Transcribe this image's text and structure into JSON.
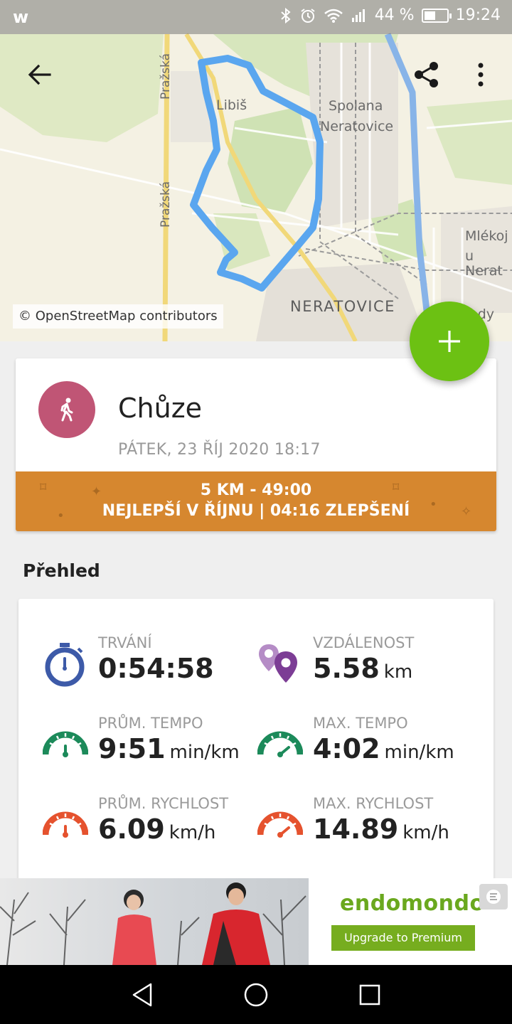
{
  "status_bar": {
    "app_glyph": "w",
    "battery_text": "44 %",
    "battery_level": 0.44,
    "time": "19:24"
  },
  "map": {
    "labels": {
      "prazska_top": "Pražská",
      "prazska_bottom": "Pražská",
      "libis": "Libiš",
      "spolana": "Spolana",
      "neratovice_upper": "Neratovice",
      "mlekojedy": "Mlékoj",
      "u_nerat": "u Nerat",
      "neratovice_town": "NERATOVICE",
      "edy": "edy"
    },
    "credit": "© OpenStreetMap contributors",
    "route_color": "#5aa6ef"
  },
  "actions": {
    "back_icon": "arrow-back-icon",
    "share_icon": "share-icon",
    "more_icon": "more-vertical-icon",
    "add_icon": "plus-icon"
  },
  "workout": {
    "activity_icon": "walking-person-icon",
    "activity_name": "Chůze",
    "date": "PÁTEK, 23 ŘÍJ 2020 18:17",
    "achievement_line1": "5 KM  -  49:00",
    "achievement_line2": "NEJLEPŠÍ V ŘÍJNU  |  04:16 ZLEPŠENÍ",
    "colors": {
      "activity_circle": "#c05575",
      "achievement_bar": "#d6872f"
    }
  },
  "overview": {
    "title": "Přehled",
    "stats": [
      {
        "label": "TRVÁNÍ",
        "value": "0:54:58",
        "unit": "",
        "icon": "stopwatch-icon"
      },
      {
        "label": "VZDÁLENOST",
        "value": "5.58",
        "unit": "km",
        "icon": "location-pins-icon"
      },
      {
        "label": "PRŮM. TEMPO",
        "value": "9:51",
        "unit": "min/km",
        "icon": "avg-pace-gauge-icon"
      },
      {
        "label": "MAX. TEMPO",
        "value": "4:02",
        "unit": "min/km",
        "icon": "max-pace-gauge-icon"
      },
      {
        "label": "PRŮM. RYCHLOST",
        "value": "6.09",
        "unit": "km/h",
        "icon": "avg-speed-gauge-icon"
      },
      {
        "label": "MAX. RYCHLOST",
        "value": "14.89",
        "unit": "km/h",
        "icon": "max-speed-gauge-icon"
      }
    ]
  },
  "ad": {
    "brand": "endomondo",
    "cta": "Upgrade to Premium",
    "close_icon": "ad-close-icon"
  },
  "nav_bar": {
    "back_icon": "nav-back-icon",
    "home_icon": "nav-home-icon",
    "recents_icon": "nav-recents-icon"
  }
}
